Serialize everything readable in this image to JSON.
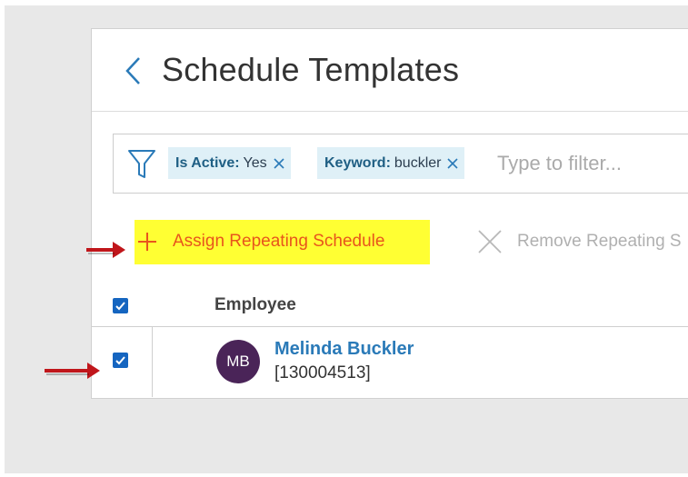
{
  "header": {
    "back_icon": "chevron-left-icon",
    "title": "Schedule Templates"
  },
  "filters": {
    "icon": "funnel-icon",
    "chips": [
      {
        "key": "Is Active:",
        "value": "Yes"
      },
      {
        "key": "Keyword:",
        "value": "buckler"
      }
    ],
    "placeholder": "Type to filter..."
  },
  "actions": {
    "assign_label": "Assign Repeating Schedule",
    "remove_label": "Remove Repeating S"
  },
  "table": {
    "header": {
      "select_all_checked": true,
      "employee_label": "Employee"
    },
    "rows": [
      {
        "checked": true,
        "avatar_initials": "MB",
        "name": "Melinda Buckler",
        "employee_id": "[130004513]"
      }
    ]
  },
  "colors": {
    "highlight": "#ffff33",
    "accent_orange": "#e8551c",
    "link_blue": "#2a7ab8",
    "chip_bg": "#dff0f7",
    "checkbox_blue": "#1565c0",
    "avatar_bg": "#4a2458",
    "annotation_arrow": "#c0161b"
  }
}
